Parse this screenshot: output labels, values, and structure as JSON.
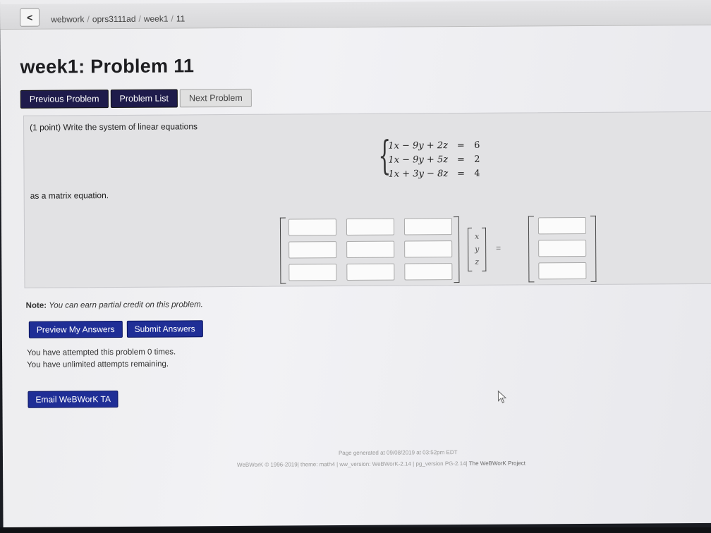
{
  "breadcrumb": {
    "back_icon": "chevron-left-icon",
    "back_glyph": "<",
    "items": [
      "webwork",
      "oprs3111ad",
      "week1",
      "11"
    ],
    "separator": "/"
  },
  "page": {
    "title": "week1: Problem 11"
  },
  "nav": {
    "previous": "Previous Problem",
    "list": "Problem List",
    "next": "Next Problem"
  },
  "problem": {
    "prompt": "(1 point) Write the system of linear equations",
    "equations": [
      {
        "lhs": "1x − 9y + 2z",
        "eq": "=",
        "rhs": "6"
      },
      {
        "lhs": "1x − 9y + 5z",
        "eq": "=",
        "rhs": "2"
      },
      {
        "lhs": "1x + 3y − 8z",
        "eq": "=",
        "rhs": "4"
      }
    ],
    "prompt2": "as a matrix equation.",
    "variables": [
      "x",
      "y",
      "z"
    ],
    "equals": "="
  },
  "note": {
    "label": "Note:",
    "text": "You can earn partial credit on this problem."
  },
  "actions": {
    "preview": "Preview My Answers",
    "submit": "Submit Answers"
  },
  "status": {
    "attempts": "You have attempted this problem 0 times.",
    "remaining": "You have unlimited attempts remaining."
  },
  "email": {
    "label": "Email WeBWorK TA"
  },
  "footer": {
    "generated": "Page generated at 09/08/2019 at 03:52pm EDT",
    "info": "WeBWorK © 1996-2019| theme: math4 | ww_version: WeBWorK-2.14 | pg_version PG-2.14|",
    "project": "The WeBWorK Project"
  },
  "colors": {
    "dark_nav": "#1e1b4b",
    "action_blue": "#1f2e96"
  }
}
